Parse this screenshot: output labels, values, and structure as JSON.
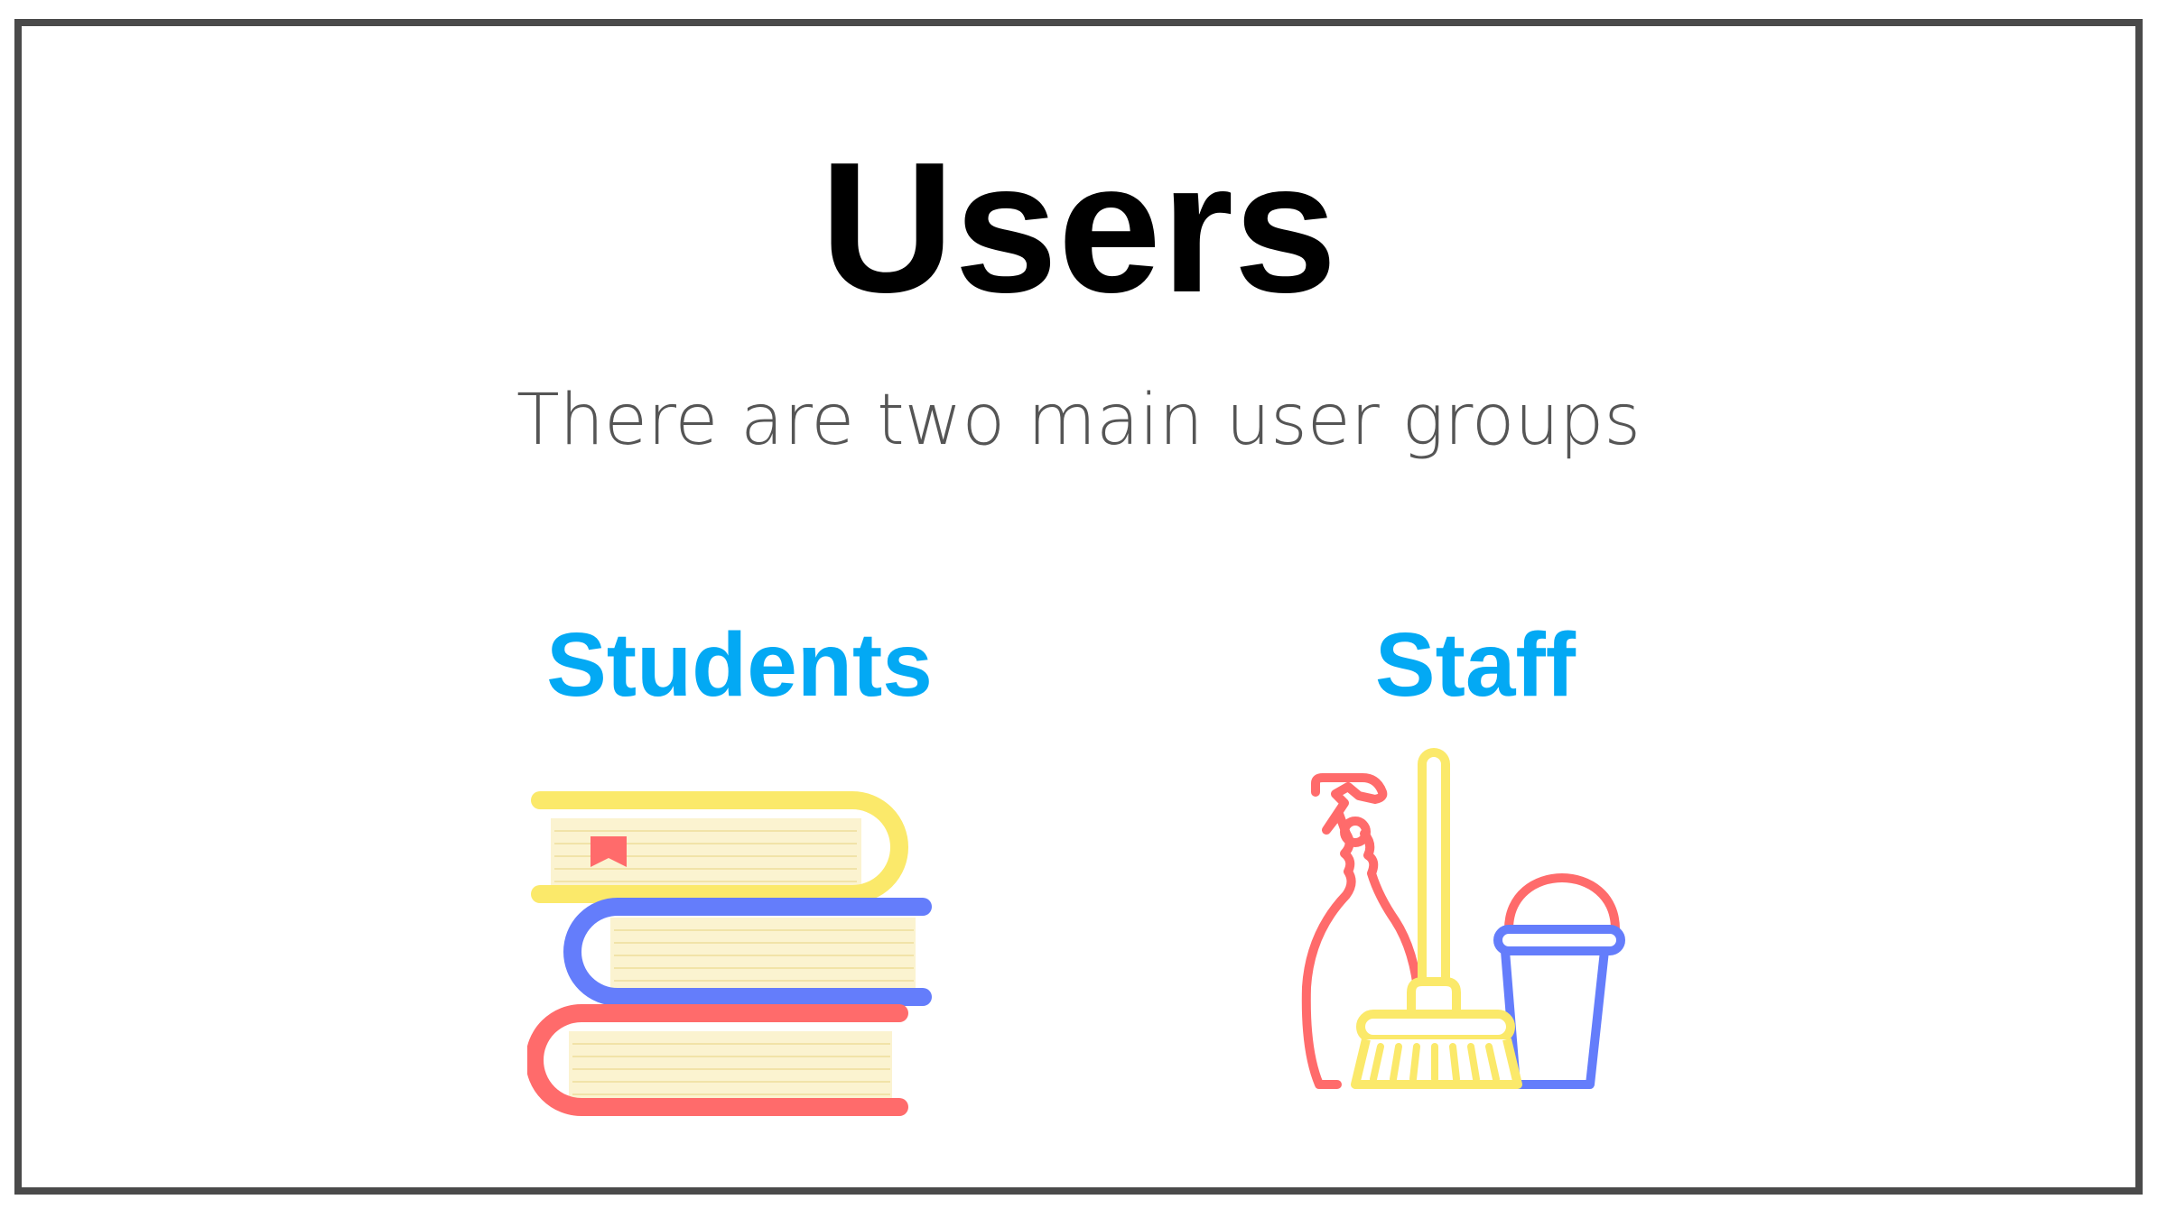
{
  "slide": {
    "title": "Users",
    "subtitle": "There are two main user groups",
    "groups": [
      {
        "label": "Students",
        "icon": "books-icon"
      },
      {
        "label": "Staff",
        "icon": "cleaning-supplies-icon"
      }
    ]
  },
  "colors": {
    "accent": "#03a9f4",
    "frame": "#4a4a4a",
    "title": "#000000",
    "subtitle": "#555555",
    "icon_yellow": "#fbe96a",
    "icon_blue": "#647dfb",
    "icon_red": "#ff6b6b",
    "page_cream": "#fbf3d0"
  }
}
